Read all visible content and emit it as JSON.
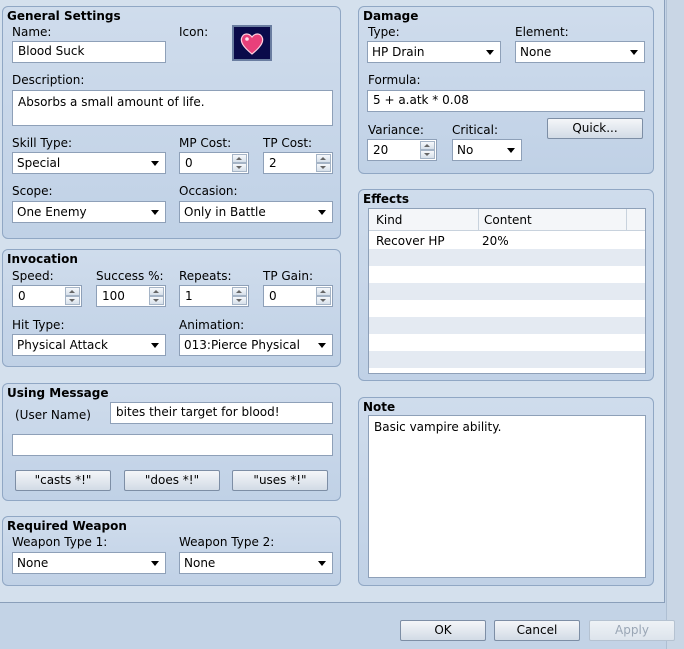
{
  "general": {
    "title": "General Settings",
    "name_label": "Name:",
    "name_value": "Blood Suck",
    "icon_label": "Icon:",
    "icon_name": "heart-icon",
    "description_label": "Description:",
    "description_value": "Absorbs a small amount of life.",
    "skill_type_label": "Skill Type:",
    "skill_type_value": "Special",
    "mp_cost_label": "MP Cost:",
    "mp_cost_value": "0",
    "tp_cost_label": "TP Cost:",
    "tp_cost_value": "2",
    "scope_label": "Scope:",
    "scope_value": "One Enemy",
    "occasion_label": "Occasion:",
    "occasion_value": "Only in Battle"
  },
  "invocation": {
    "title": "Invocation",
    "speed_label": "Speed:",
    "speed_value": "0",
    "success_label": "Success %:",
    "success_value": "100",
    "repeats_label": "Repeats:",
    "repeats_value": "1",
    "tp_gain_label": "TP Gain:",
    "tp_gain_value": "0",
    "hit_type_label": "Hit Type:",
    "hit_type_value": "Physical Attack",
    "animation_label": "Animation:",
    "animation_value": "013:Pierce Physical"
  },
  "using_message": {
    "title": "Using Message",
    "user_name_label": "(User Name)",
    "line1_value": "bites their target for blood!",
    "line2_value": "",
    "casts_button": "\"casts *!\"",
    "does_button": "\"does *!\"",
    "uses_button": "\"uses *!\""
  },
  "required_weapon": {
    "title": "Required Weapon",
    "type1_label": "Weapon Type 1:",
    "type1_value": "None",
    "type2_label": "Weapon Type 2:",
    "type2_value": "None"
  },
  "damage": {
    "title": "Damage",
    "type_label": "Type:",
    "type_value": "HP Drain",
    "element_label": "Element:",
    "element_value": "None",
    "formula_label": "Formula:",
    "formula_value": "5 + a.atk * 0.08",
    "quick_button": "Quick...",
    "variance_label": "Variance:",
    "variance_value": "20",
    "critical_label": "Critical:",
    "critical_value": "No"
  },
  "effects": {
    "title": "Effects",
    "col_kind": "Kind",
    "col_content": "Content",
    "rows": [
      {
        "kind": "Recover HP",
        "content": "20%"
      }
    ]
  },
  "note": {
    "title": "Note",
    "value": "Basic vampire ability."
  },
  "footer": {
    "ok": "OK",
    "cancel": "Cancel",
    "apply": "Apply"
  },
  "colors": {
    "icon_background": "#0a0a4a",
    "heart": "#e8407a"
  }
}
